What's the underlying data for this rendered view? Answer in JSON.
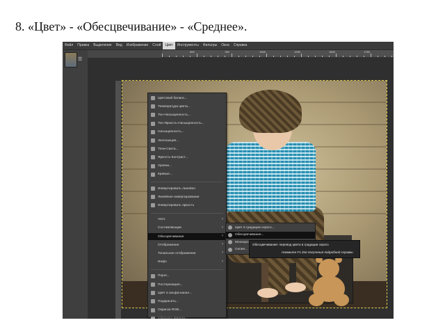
{
  "slide": {
    "title": "8. «Цвет» - «Обесцвечивание» - «Среднее»."
  },
  "menubar": [
    "Файл",
    "Правка",
    "Выделение",
    "Вид",
    "Изображение",
    "Слой",
    "Цвет",
    "Инструменты",
    "Фильтры",
    "Окна",
    "Справка"
  ],
  "ruler": {
    "labels": [
      "500",
      "750",
      "1000",
      "1250",
      "1500",
      "1750"
    ]
  },
  "color_menu": {
    "items": [
      {
        "label": "Цветовой баланс...",
        "icon": "balance-icon"
      },
      {
        "label": "Температура цвета...",
        "icon": "temperature-icon"
      },
      {
        "label": "Тон-Насыщенность...",
        "icon": "hue-saturation-icon"
      },
      {
        "label": "Тон-Яркость-Насыщенность...",
        "icon": "hue-chroma-icon"
      },
      {
        "label": "Насыщенность...",
        "icon": "saturation-icon"
      },
      {
        "label": "Экспозиция...",
        "icon": "exposure-icon"
      },
      {
        "label": "Тени-Света...",
        "icon": "shadows-highlights-icon"
      },
      {
        "label": "Яркость-Контраст...",
        "icon": "brightness-contrast-icon"
      },
      {
        "label": "Уровни...",
        "icon": "levels-icon"
      },
      {
        "label": "Кривые...",
        "icon": "curves-icon"
      },
      {
        "label": "Инвертировать линейно",
        "icon": "invert-linear-icon"
      },
      {
        "label": "Линейное инвертирование",
        "icon": "invert-icon"
      },
      {
        "label": "Инвертировать яркость",
        "icon": "invert-value-icon"
      },
      {
        "label": "Авто",
        "icon": "",
        "submenu": true
      },
      {
        "label": "Составляющие",
        "icon": "",
        "submenu": true
      },
      {
        "label": "Обесцвечивание",
        "icon": "",
        "submenu": true,
        "highlighted": true
      },
      {
        "label": "Отображение",
        "icon": "",
        "submenu": true
      },
      {
        "label": "Тональное отображение",
        "icon": "",
        "submenu": true
      },
      {
        "label": "Инфо",
        "icon": "",
        "submenu": true
      },
      {
        "label": "Порог...",
        "icon": "threshold-icon"
      },
      {
        "label": "Постеризация...",
        "icon": "posterize-icon"
      },
      {
        "label": "Цвет в альфа-канал...",
        "icon": "color-to-alpha-icon"
      },
      {
        "label": "Подкрасить...",
        "icon": "colorize-icon"
      },
      {
        "label": "Окраска RGB...",
        "icon": "rgb-icon"
      },
      {
        "label": "Сбросить фильтр...",
        "icon": "reset-icon",
        "disabled": true
      }
    ]
  },
  "desaturate_submenu": {
    "items": [
      {
        "label": "Цвет в градации серого...",
        "highlighted": false
      },
      {
        "label": "Обесцвечивание...",
        "highlighted": true
      },
      {
        "label": "Монохромный микшер...",
        "highlighted": false
      },
      {
        "label": "Сепия...",
        "highlighted": false
      }
    ]
  },
  "tooltip": {
    "line1": "Обесцвечивание: перевод цвета в градации серого",
    "line2": "Нажмите F1 для получения подробной справки"
  },
  "colors": {
    "accent": "#d9c64a",
    "menu_bg": "#404040",
    "highlight": "#111111"
  }
}
